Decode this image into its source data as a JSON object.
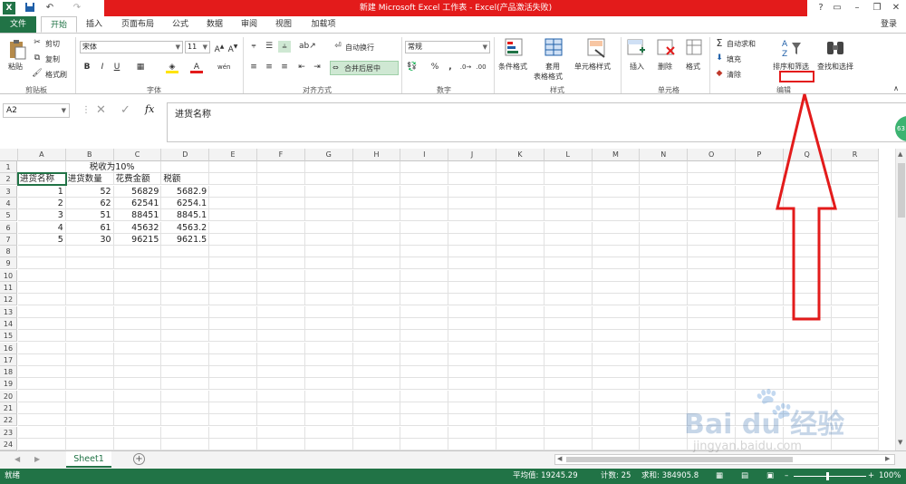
{
  "titlebar": {
    "title": "新建 Microsoft Excel 工作表 - Excel(产品激活失败)",
    "help": "?",
    "login": "登录"
  },
  "tabs": [
    "文件",
    "开始",
    "插入",
    "页面布局",
    "公式",
    "数据",
    "审阅",
    "视图",
    "加载项"
  ],
  "ribbon": {
    "clipboard": {
      "paste": "粘贴",
      "cut": "剪切",
      "copy": "复制",
      "format_painter": "格式刷",
      "label": "剪贴板"
    },
    "font": {
      "name": "宋体",
      "size": "11",
      "bold": "B",
      "italic": "I",
      "underline": "U",
      "label": "字体",
      "font_color_letter": "A",
      "wen": "wén"
    },
    "alignment": {
      "wrap": "自动换行",
      "merge": "合并后居中",
      "label": "对齐方式"
    },
    "number": {
      "format": "常规",
      "percent": "%",
      "comma": ",",
      "label": "数字"
    },
    "styles": {
      "conditional": "条件格式",
      "table1": "套用",
      "table2": "表格格式",
      "cell_styles": "单元格样式",
      "label": "样式"
    },
    "cells": {
      "insert": "插入",
      "delete": "删除",
      "format": "格式",
      "label": "单元格"
    },
    "editing": {
      "autosum": "自动求和",
      "fill": "填充",
      "clear": "清除",
      "sort": "排序和筛选",
      "find": "查找和选择",
      "label": "编辑",
      "sigma": "Σ"
    }
  },
  "formula_bar": {
    "name_box": "A2",
    "fx": "fx",
    "content": "进货名称",
    "cancel": "✕",
    "enter": "✓"
  },
  "columns": [
    "A",
    "B",
    "C",
    "D",
    "E",
    "F",
    "G",
    "H",
    "I",
    "J",
    "K",
    "L",
    "M",
    "N",
    "O",
    "P",
    "Q",
    "R"
  ],
  "rows": [
    "1",
    "2",
    "3",
    "4",
    "5",
    "6",
    "7",
    "8",
    "9",
    "10",
    "11",
    "12",
    "13",
    "14",
    "15",
    "16",
    "17",
    "18",
    "19",
    "20",
    "21",
    "22",
    "23",
    "24"
  ],
  "cells": {
    "B1": "税收为10%",
    "A2": "进货名称",
    "B2": "进货数量",
    "C2": "花费金额",
    "D2": "税额",
    "A3": "1",
    "B3": "52",
    "C3": "56829",
    "D3": "5682.9",
    "A4": "2",
    "B4": "62",
    "C4": "62541",
    "D4": "6254.1",
    "A5": "3",
    "B5": "51",
    "C5": "88451",
    "D5": "8845.1",
    "A6": "4",
    "B6": "61",
    "C6": "45632",
    "D6": "4563.2",
    "A7": "5",
    "B7": "30",
    "C7": "96215",
    "D7": "9621.5"
  },
  "sheet": {
    "name": "Sheet1",
    "add": "+"
  },
  "status": {
    "ready": "就绪",
    "average": "平均值: 19245.29",
    "count": "计数: 25",
    "sum": "求和: 384905.8",
    "zoom": "100%"
  },
  "side_badge": "63",
  "watermark": {
    "brand": "Bai du 经验",
    "url": "jingyan.baidu.com"
  },
  "colors": {
    "excel_green": "#217346",
    "title_red": "#e31b1b",
    "annotation_red": "#e31b1b"
  }
}
